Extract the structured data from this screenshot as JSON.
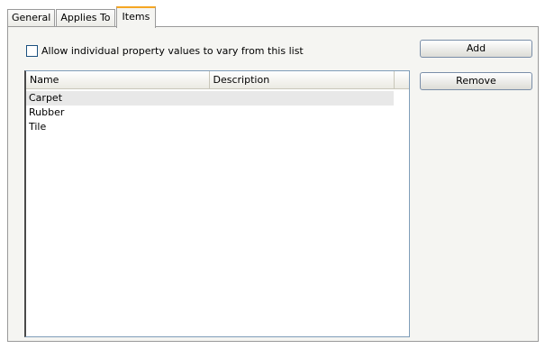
{
  "tabs": [
    "General",
    "Applies To",
    "Items"
  ],
  "active_tab": "Items",
  "checkbox": {
    "label": "Allow individual property values to vary from this list",
    "checked": false
  },
  "list": {
    "columns": [
      "Name",
      "Description"
    ],
    "rows": [
      {
        "name": "Carpet",
        "description": ""
      },
      {
        "name": "Rubber",
        "description": ""
      },
      {
        "name": "Tile",
        "description": ""
      }
    ],
    "selected_row": "Carpet"
  },
  "buttons": {
    "add": "Add",
    "remove": "Remove"
  }
}
